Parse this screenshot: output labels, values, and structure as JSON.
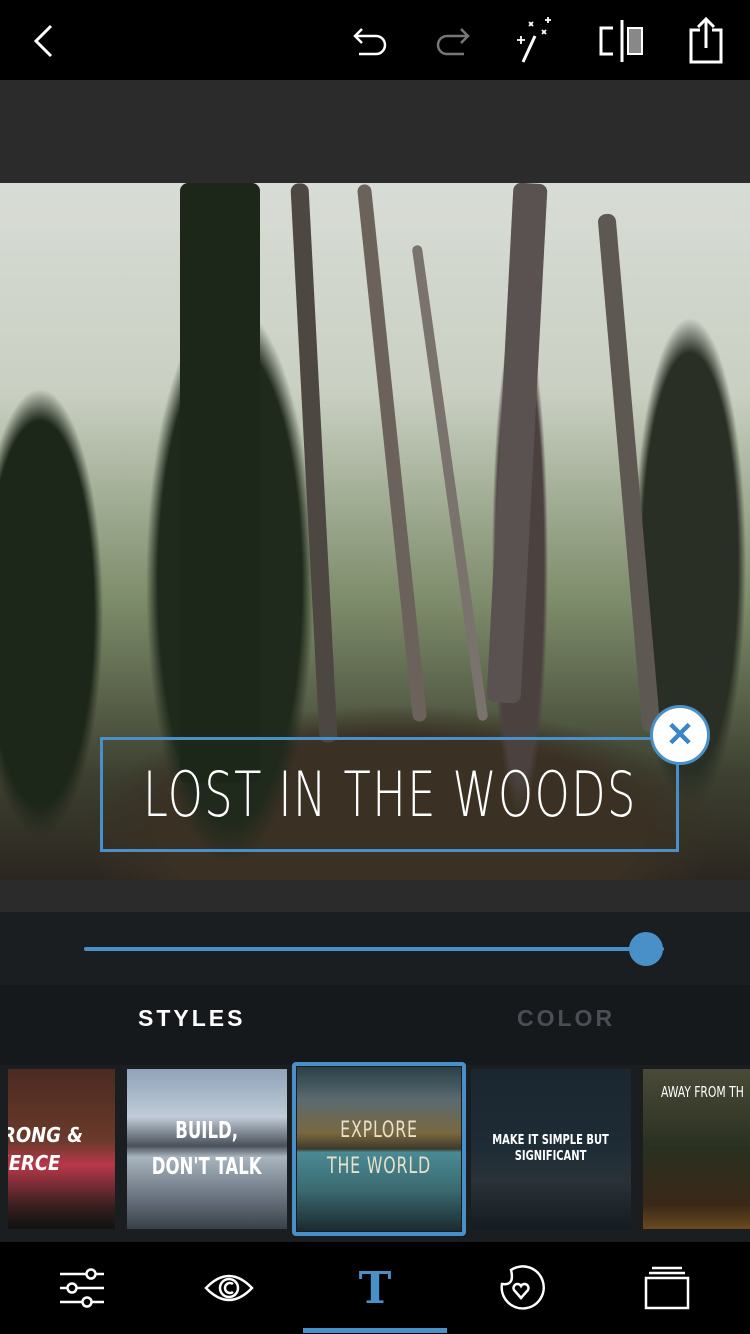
{
  "toolbar": {
    "icons": [
      "back-icon",
      "undo-icon",
      "redo-icon",
      "magic-wand-icon",
      "compare-icon",
      "share-icon"
    ],
    "redo_enabled": false
  },
  "canvas": {
    "overlay_text": "Lost in the woods",
    "close_icon": "close-icon"
  },
  "slider": {
    "value_percent": 97
  },
  "tabs": [
    {
      "label": "STYLES",
      "active": true
    },
    {
      "label": "COLOR",
      "active": false
    }
  ],
  "styles": [
    {
      "text1": "RONG &",
      "text2": "IERCE"
    },
    {
      "text1": "BUILD,",
      "text2": "DON'T TALK"
    },
    {
      "text1": "EXPLORE",
      "text2": "THE WORLD",
      "selected": true
    },
    {
      "text1": "MAKE IT SIMPLE BUT",
      "text2": "SIGNIFICANT"
    },
    {
      "text1": "AWAY FROM TH"
    }
  ],
  "bottom_nav": [
    {
      "icon": "adjust-sliders-icon"
    },
    {
      "icon": "eye-icon"
    },
    {
      "icon": "text-icon",
      "active": true
    },
    {
      "icon": "sticker-icon"
    },
    {
      "icon": "layers-icon"
    }
  ],
  "colors": {
    "accent": "#4a90c8",
    "background": "#000000",
    "panel": "#1b1e21"
  }
}
